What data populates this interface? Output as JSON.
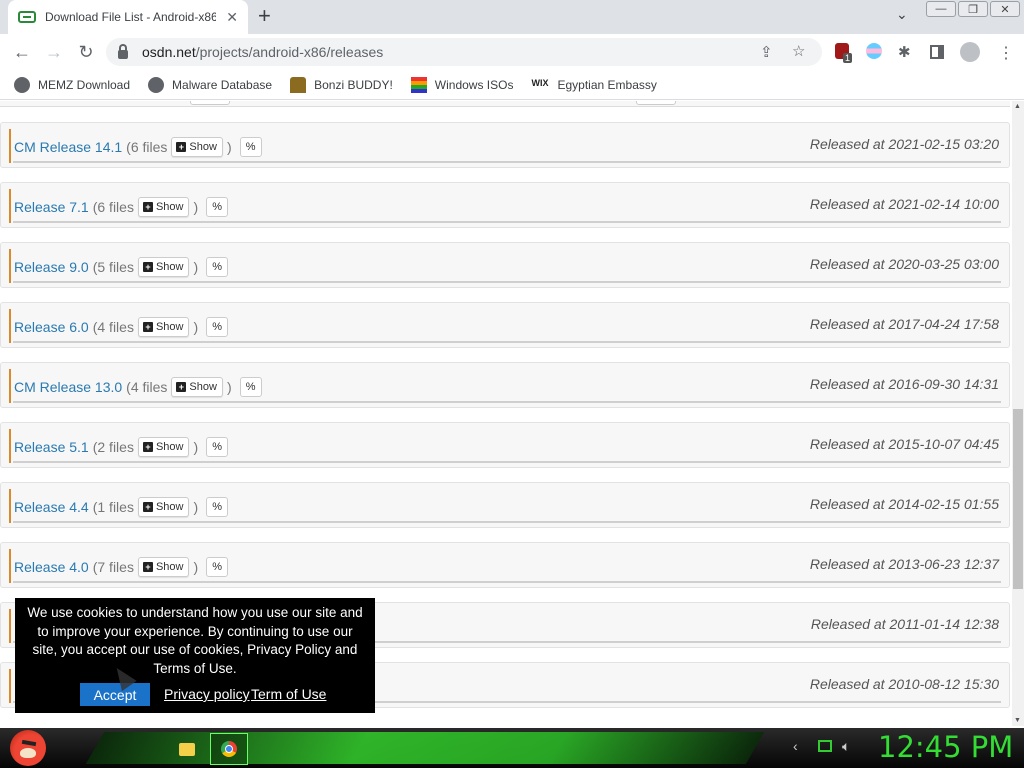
{
  "browser": {
    "tab_title": "Download File List - Android-x86",
    "tab_close": "✕",
    "new_tab": "+",
    "tab_dropdown": "⌄",
    "window_buttons": [
      "—",
      "❐",
      "✕"
    ],
    "url_host": "osdn.net",
    "url_path": "/projects/android-x86/releases",
    "bookmarks": [
      {
        "label": "MEMZ Download",
        "icon": "globe-icon"
      },
      {
        "label": "Malware Database",
        "icon": "globe-icon"
      },
      {
        "label": "Bonzi BUDDY!",
        "icon": "bonzi-icon"
      },
      {
        "label": "Windows ISOs",
        "icon": "rainbow-icon"
      },
      {
        "label": "Egyptian Embassy",
        "icon": "wix-icon"
      }
    ],
    "wix_text": "WIX",
    "ext_badge": "1"
  },
  "releases": [
    {
      "name": "CM Release 14.1",
      "count": "(6 files",
      "show": "Show",
      "date": "Released at 2021-02-15 03:20"
    },
    {
      "name": "Release 7.1",
      "count": "(6 files",
      "show": "Show",
      "date": "Released at 2021-02-14 10:00"
    },
    {
      "name": "Release 9.0",
      "count": "(5 files",
      "show": "Show",
      "date": "Released at 2020-03-25 03:00"
    },
    {
      "name": "Release 6.0",
      "count": "(4 files",
      "show": "Show",
      "date": "Released at 2017-04-24 17:58"
    },
    {
      "name": "CM Release 13.0",
      "count": "(4 files",
      "show": "Show",
      "date": "Released at 2016-09-30 14:31"
    },
    {
      "name": "Release 5.1",
      "count": "(2 files",
      "show": "Show",
      "date": "Released at 2015-10-07 04:45"
    },
    {
      "name": "Release 4.4",
      "count": "(1 files",
      "show": "Show",
      "date": "Released at 2014-02-15 01:55"
    },
    {
      "name": "Release 4.0",
      "count": "(7 files",
      "show": "Show",
      "date": "Released at 2013-06-23 12:37"
    },
    {
      "name": "",
      "count": "",
      "show": "",
      "date": "Released at 2011-01-14 12:38"
    },
    {
      "name": "",
      "count": "",
      "show": "",
      "date": "Released at 2010-08-12 15:30"
    }
  ],
  "cookie": {
    "message": "We use cookies to understand how you use our site and to improve your experience. By continuing to use our site, you accept our use of cookies, Privacy Policy and Terms of Use.",
    "accept": "Accept",
    "privacy_link": "Privacy policy",
    "terms_link": "Term of Use"
  },
  "taskbar": {
    "clock": "12:45 PM"
  }
}
